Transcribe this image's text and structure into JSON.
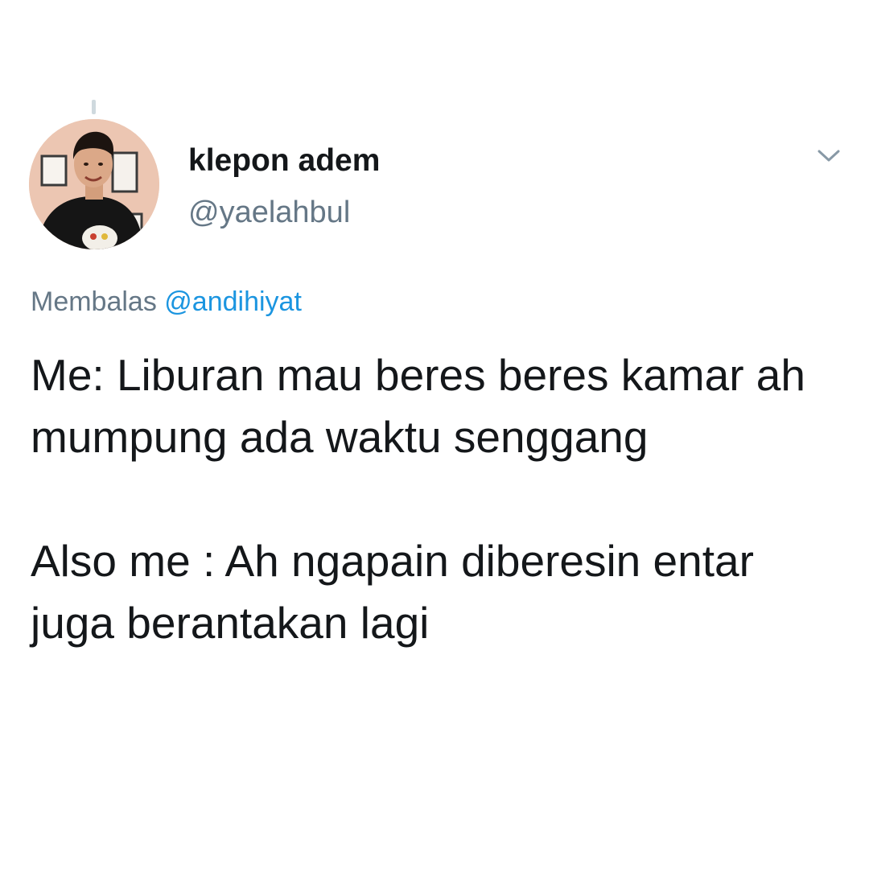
{
  "tweet": {
    "author": {
      "display_name": "klepon adem",
      "handle": "@yaelahbul"
    },
    "reply": {
      "prefix": "Membalas",
      "mention": "@andihiyat"
    },
    "paragraphs": [
      "Me: Liburan mau beres beres kamar ah mumpung ada waktu senggang",
      "Also me : Ah ngapain diberesin entar juga berantakan lagi"
    ],
    "menu_icon": "chevron-down-icon"
  },
  "colors": {
    "text": "#14171a",
    "secondary": "#657786",
    "link": "#1b95e0",
    "background": "#ffffff"
  }
}
